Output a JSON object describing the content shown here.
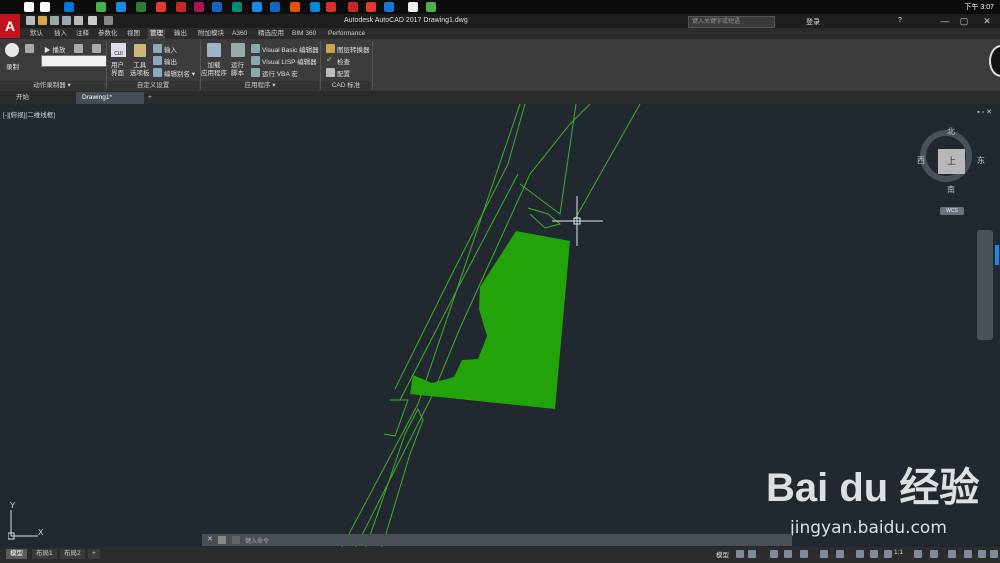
{
  "taskbar": {
    "time": "下午 3:07",
    "icon_colors": [
      "#ffffff",
      "#ffffff",
      "#0078d7",
      "#4caf50",
      "#1e88e5",
      "#2e7d32",
      "#e53935",
      "#c62828",
      "#ad1457",
      "#1565c0",
      "#00897b",
      "#1e88e5",
      "#1565c0",
      "#e65100",
      "#0288d1",
      "#d32f2f",
      "#c62828",
      "#e53935",
      "#1976d2",
      "#eceff1",
      "#4caf50"
    ]
  },
  "titlebar": {
    "app_logo": "A",
    "title": "Autodesk AutoCAD 2017    Drawing1.dwg",
    "search_placeholder": "键入关键字或短语",
    "user": "登录",
    "minimize": "—",
    "maximize": "▢",
    "close": "✕",
    "help": "?"
  },
  "ribbon_tabs": [
    "默认",
    "插入",
    "注释",
    "参数化",
    "视图",
    "管理",
    "输出",
    "附加模块",
    "A360",
    "精选应用",
    "BIM 360",
    "Performance"
  ],
  "active_ribbon_tab": "管理",
  "ribbon": {
    "record_label": "录制",
    "play_label": "播放",
    "action_recorder_title": "动作录制器 ▾",
    "cui_label": "CUI",
    "user_interface_label": "用户\n界面",
    "tool_palettes_label": "工具\n选项板",
    "import_label": "输入",
    "export_label": "输出",
    "edit_aliases_label": "编辑别名 ▾",
    "customization_title": "自定义设置",
    "load_app_label": "加载\n应用程序",
    "run_script_label": "运行\n脚本",
    "vb_editor_label": "Visual Basic 编辑器",
    "lisp_editor_label": "Visual LISP 编辑器",
    "run_vba_label": "运行 VBA 宏",
    "applications_title": "应用程序 ▾",
    "layer_translator_label": "图层转换器",
    "check_label": "检查",
    "configure_label": "配置",
    "cad_standards_title": "CAD 标准"
  },
  "file_tabs": [
    "开始",
    "Drawing1*"
  ],
  "active_file_tab": "Drawing1*",
  "viewport": {
    "label": "[-][俯视][二维线框]",
    "controls": "▪ ▫ ✕",
    "viewcube_face": "上",
    "north": "北",
    "south": "南",
    "east": "东",
    "west": "西",
    "wcs": "WCS",
    "fill_color": "#23a30a",
    "line_color": "#3fae2a",
    "ucs_x": "X",
    "ucs_y": "Y"
  },
  "command_line": {
    "placeholder": "键入命令"
  },
  "status_tabs": [
    "模型",
    "布局1",
    "布局2",
    "+"
  ],
  "active_status_tab": "模型",
  "status_right": {
    "model_label": "模型",
    "scale": "1:1"
  },
  "watermark": {
    "logo": "Bai du 经验",
    "url": "jingyan.baidu.com"
  }
}
